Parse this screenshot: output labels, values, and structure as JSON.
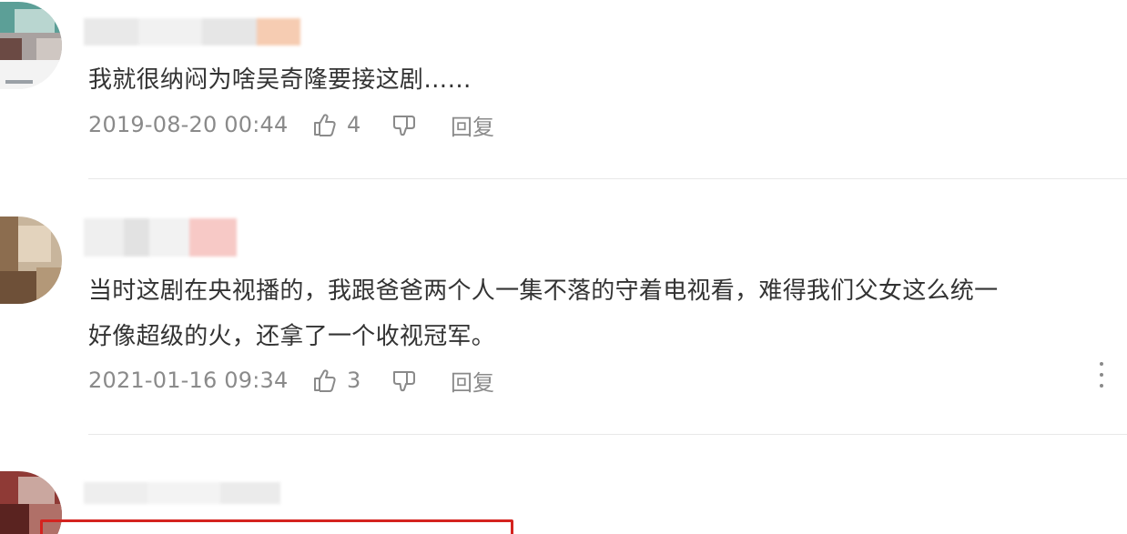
{
  "comments": [
    {
      "text": "我就很纳闷为啥吴奇隆要接这剧……",
      "date": "2019-08-20 00:44",
      "likes": "4",
      "reply_label": "回复"
    },
    {
      "text_line1": "当时这剧在央视播的，我跟爸爸两个人一集不落的守着电视看，难得我们父女这么统一",
      "text_line2": "好像超级的火，还拿了一个收视冠军。",
      "date": "2021-01-16 09:34",
      "likes": "3",
      "reply_label": "回复"
    },
    {}
  ],
  "icons": {
    "like": "thumbs-up-icon",
    "dislike": "thumbs-down-icon",
    "more": "more-vertical-icon"
  },
  "colors": {
    "text": "#333333",
    "meta": "#8a8a8a",
    "highlight": "#d4231f"
  }
}
